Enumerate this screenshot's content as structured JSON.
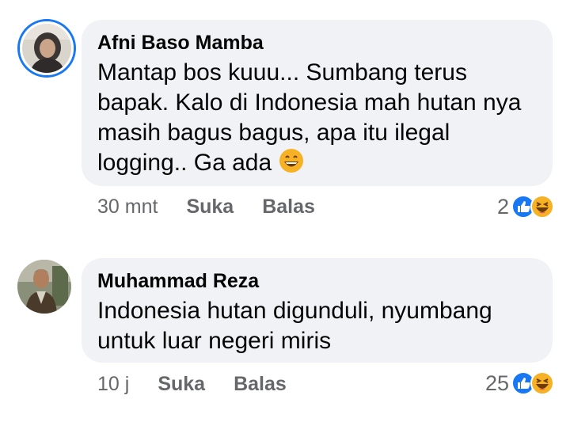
{
  "comments": [
    {
      "author": "Afni Baso Mamba",
      "text": "Mantap bos kuuu... Sumbang terus bapak. Kalo di Indonesia mah hutan nya masih bagus bagus, apa itu ilegal logging.. Ga ada",
      "inline_emoji": "grinning-face",
      "time": "30 mnt",
      "like_label": "Suka",
      "reply_label": "Balas",
      "reaction_count": "2",
      "reactions": [
        "like-icon",
        "haha-icon"
      ],
      "has_story_ring": true
    },
    {
      "author": "Muhammad Reza",
      "text": "Indonesia hutan digunduli, nyumbang untuk luar negeri miris",
      "time": "10 j",
      "like_label": "Suka",
      "reply_label": "Balas",
      "reaction_count": "25",
      "reactions": [
        "like-icon",
        "haha-icon"
      ],
      "has_story_ring": false
    }
  ],
  "colors": {
    "bubble": "#f0f2f5",
    "meta_text": "#65676b",
    "like_blue": "#1877f2",
    "haha_yellow": "#f7b125"
  }
}
